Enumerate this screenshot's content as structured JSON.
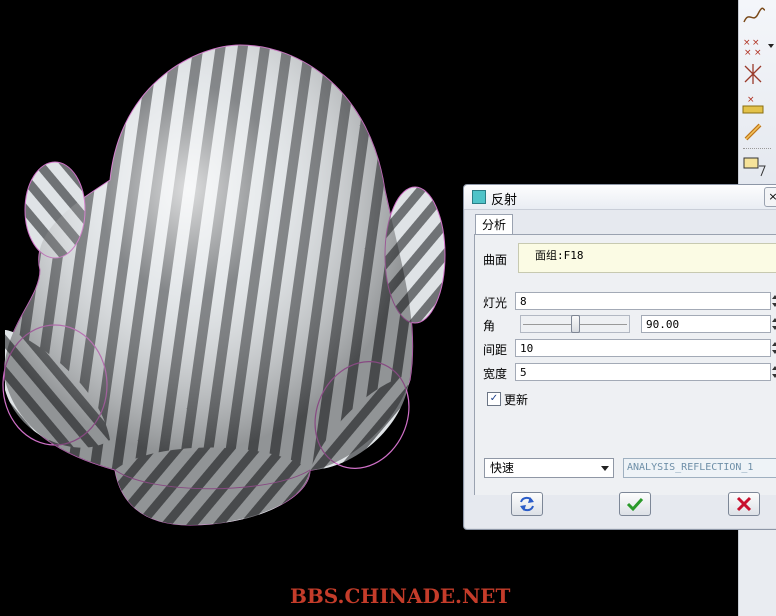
{
  "dialog": {
    "title": "反射",
    "close_label": "×",
    "tab": "分析",
    "surface": {
      "label": "曲面",
      "value": "面组:F18"
    },
    "light": {
      "label": "灯光",
      "value": "8"
    },
    "angle": {
      "label": "角",
      "value": "90.00",
      "slider_fraction": 0.5
    },
    "spacing": {
      "label": "间距",
      "value": "10"
    },
    "width": {
      "label": "宽度",
      "value": "5"
    },
    "update": {
      "label": "更新",
      "checked": true
    },
    "mode": {
      "selected": "快速"
    },
    "analysis_name": "ANALYSIS_REFLECTION_1",
    "buttons": {
      "refresh": "refresh-icon",
      "ok": "check-icon",
      "cancel": "x-icon"
    }
  },
  "toolbar": {
    "icons": [
      "curve-icon",
      "points-icon",
      "axis-icon",
      "coordinate-system-icon",
      "chain-icon",
      "note-icon"
    ]
  },
  "watermark": "BBS.CHINADE.NET",
  "colors": {
    "accent_ok": "#2a9a2a",
    "cancel": "#c8102e",
    "surface_box": "#fbfbe4",
    "dialog_bg": "#e6e9ef"
  }
}
